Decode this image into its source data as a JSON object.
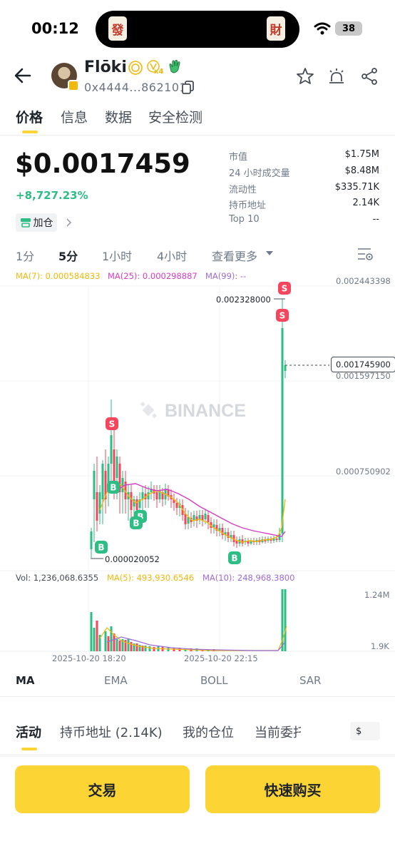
{
  "status_bar": {
    "time": "00:12",
    "battery": "38",
    "tile_left": "發",
    "tile_right": "財"
  },
  "header": {
    "token_name": "Flōki",
    "badge_multiplier": "x4",
    "address": "0x4444...862101"
  },
  "tabs": [
    "价格",
    "信息",
    "数据",
    "安全检测"
  ],
  "price": {
    "value": "$0.0017459",
    "change": "+8,727.23%",
    "add_position": "加仓"
  },
  "stats": [
    {
      "label": "市值",
      "value": "$1.75M"
    },
    {
      "label": "24 小时成交量",
      "value": "$8.48M"
    },
    {
      "label": "流动性",
      "value": "$335.71K"
    },
    {
      "label": "持币地址",
      "value": "2.14K"
    },
    {
      "label": "Top 10",
      "value": "--"
    }
  ],
  "intervals": [
    "1分",
    "5分",
    "1小时",
    "4小时",
    "查看更多"
  ],
  "active_interval": "5分",
  "chart": {
    "ma_legend": {
      "ma7": "MA(7): 0.000584833",
      "ma25": "MA(25): 0.000298887",
      "ma99": "MA(99): --"
    },
    "price_axis": [
      "0.002443398",
      "0.001597150",
      "0.000750902"
    ],
    "current_price_tag": "0.001745900",
    "high_label": "0.002328000",
    "low_label": "0.000020052",
    "watermark": "BINANCE",
    "vol_legend": {
      "vol": "Vol: 1,236,068.6355",
      "ma5": "MA(5): 493,930.6546",
      "ma10": "MA(10): 248,968.3800"
    },
    "vol_axis": [
      "1.24M",
      "1.9K"
    ],
    "time_axis": [
      "2025-10-20 18:20",
      "2025-10-20 22:15"
    ],
    "buy_marker": "B",
    "sell_marker": "S",
    "colors": {
      "up": "#2ebd85",
      "down": "#f6465d",
      "ma7": "#f0b90b",
      "ma25": "#d63dc4",
      "ma99": "#9b6bd8"
    }
  },
  "indicator_tabs": [
    "MA",
    "EMA",
    "BOLL",
    "SAR"
  ],
  "activity_tabs": [
    "活动",
    "持币地址 (2.14K)",
    "我的仓位",
    "当前委托"
  ],
  "currency": "$",
  "buttons": {
    "trade": "交易",
    "quick_buy": "快速购买"
  }
}
